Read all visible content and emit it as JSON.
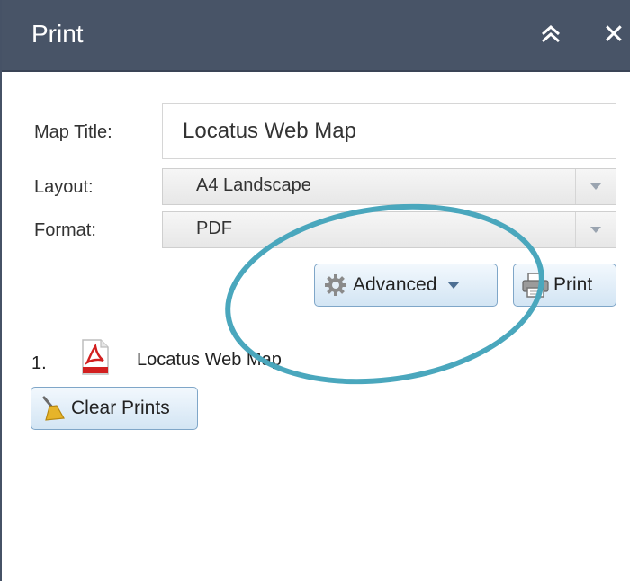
{
  "panel": {
    "title": "Print",
    "collapse_icon": "double-chevron-up-icon",
    "close_icon": "close-icon",
    "close_glyph": "✕"
  },
  "form": {
    "map_title_label": "Map Title:",
    "map_title_value": "Locatus Web Map",
    "layout_label": "Layout:",
    "layout_value": "A4 Landscape",
    "format_label": "Format:",
    "format_value": "PDF"
  },
  "actions": {
    "advanced_label": "Advanced",
    "print_label": "Print",
    "advanced_icon": "gear-icon",
    "print_icon": "printer-icon"
  },
  "results": {
    "items": [
      {
        "number": "1.",
        "title": "Locatus Web Map",
        "icon": "pdf-file-icon"
      }
    ],
    "clear_label": "Clear Prints",
    "clear_icon": "broom-icon"
  },
  "colors": {
    "titlebar": "#485467",
    "highlight_circle": "#4aa7bd",
    "button_border": "#7fa6c8"
  }
}
